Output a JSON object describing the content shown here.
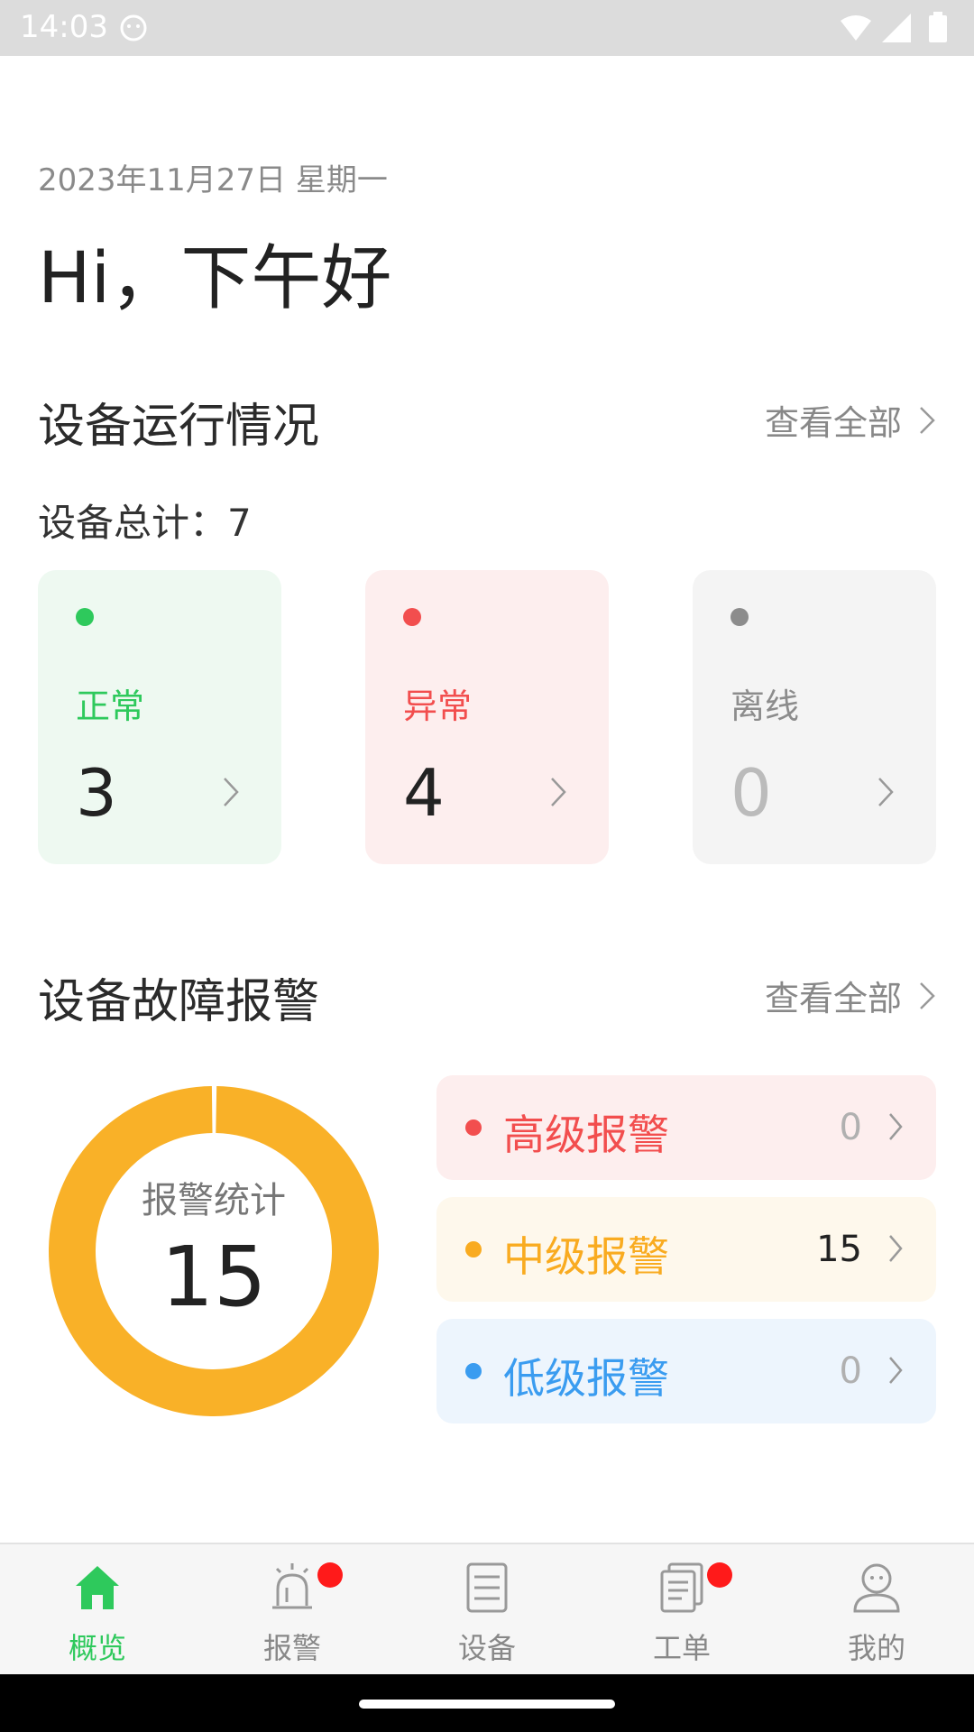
{
  "status_bar": {
    "time": "14:03"
  },
  "header": {
    "date": "2023年11月27日 星期一",
    "greeting": "Hi，下午好"
  },
  "device_section": {
    "title": "设备运行情况",
    "view_all": "查看全部",
    "total_label": "设备总计：7",
    "cards": [
      {
        "label": "正常",
        "count": "3",
        "color": "#2ec95c",
        "bg": "#eef9f1",
        "count_color": "#222222"
      },
      {
        "label": "异常",
        "count": "4",
        "color": "#f24e4e",
        "bg": "#fdeeee",
        "count_color": "#222222"
      },
      {
        "label": "离线",
        "count": "0",
        "color": "#8c8c8c",
        "bg": "#f4f4f4",
        "count_color": "#bbbbbb"
      }
    ]
  },
  "alarm_section": {
    "title": "设备故障报警",
    "view_all": "查看全部",
    "donut": {
      "label": "报警统计",
      "total": "15",
      "color": "#f9b128",
      "fraction": 1.0
    },
    "levels": [
      {
        "label": "高级报警",
        "value": "0",
        "color": "#f24e4e",
        "bg": "#fdeeee",
        "value_color": "#b0b0b0"
      },
      {
        "label": "中级报警",
        "value": "15",
        "color": "#f9ab20",
        "bg": "#fef8ec",
        "value_color": "#222222"
      },
      {
        "label": "低级报警",
        "value": "0",
        "color": "#3a9cf0",
        "bg": "#edf5fd",
        "value_color": "#b0b0b0"
      }
    ]
  },
  "bottom_nav": {
    "active_color": "#2ec95c",
    "items": [
      {
        "label": "概览",
        "icon": "home-icon",
        "active": true,
        "badge": false
      },
      {
        "label": "报警",
        "icon": "alarm-icon",
        "active": false,
        "badge": true
      },
      {
        "label": "设备",
        "icon": "server-icon",
        "active": false,
        "badge": false
      },
      {
        "label": "工单",
        "icon": "document-icon",
        "active": false,
        "badge": true
      },
      {
        "label": "我的",
        "icon": "user-icon",
        "active": false,
        "badge": false
      }
    ]
  }
}
